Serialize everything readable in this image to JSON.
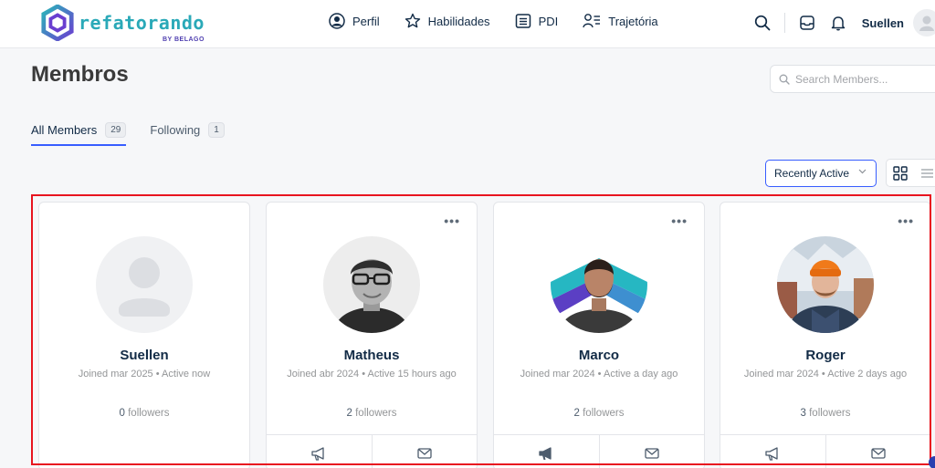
{
  "brand": {
    "name": "refatorando",
    "sub": "BY BELAGO",
    "colors": {
      "teal": "#2aa9b8",
      "purple": "#6a4fd0"
    }
  },
  "nav": [
    {
      "label": "Perfil",
      "icon": "user-circle-icon"
    },
    {
      "label": "Habilidades",
      "icon": "star-icon"
    },
    {
      "label": "PDI",
      "icon": "list-icon"
    },
    {
      "label": "Trajetória",
      "icon": "user-path-icon"
    }
  ],
  "header": {
    "user_name": "Suellen"
  },
  "page": {
    "title": "Membros"
  },
  "search": {
    "placeholder": "Search Members..."
  },
  "tabs": [
    {
      "label": "All Members",
      "count": "29",
      "active": true
    },
    {
      "label": "Following",
      "count": "1",
      "active": false
    }
  ],
  "sort": {
    "selected": "Recently Active"
  },
  "members": [
    {
      "name": "Suellen",
      "joined": "Joined mar 2025",
      "active": "Active now",
      "followers_count": "0",
      "followers_label": "followers"
    },
    {
      "name": "Matheus",
      "joined": "Joined abr 2024",
      "active": "Active 15 hours ago",
      "followers_count": "2",
      "followers_label": "followers"
    },
    {
      "name": "Marco",
      "joined": "Joined mar 2024",
      "active": "Active a day ago",
      "followers_count": "2",
      "followers_label": "followers"
    },
    {
      "name": "Roger",
      "joined": "Joined mar 2024",
      "active": "Active 2 days ago",
      "followers_count": "3",
      "followers_label": "followers"
    }
  ],
  "colors": {
    "accent": "#385dff",
    "highlight": "#e8141f"
  }
}
